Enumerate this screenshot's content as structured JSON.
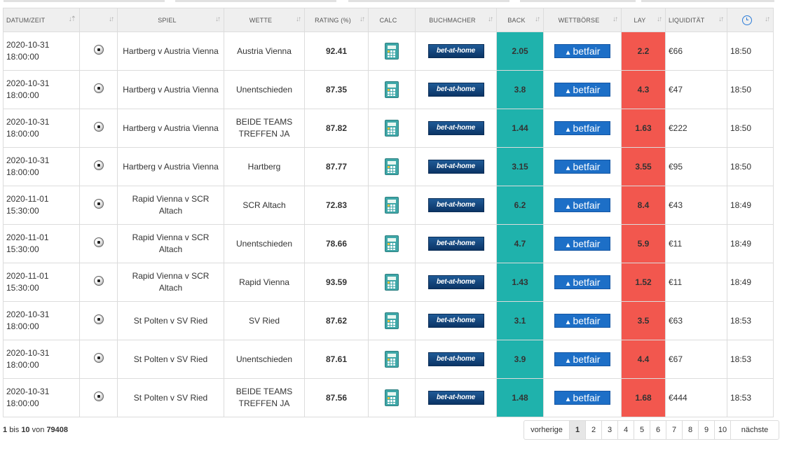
{
  "columns": {
    "datum": "DATUM/ZEIT",
    "spiel": "SPIEL",
    "wette": "WETTE",
    "rating": "RATING (%)",
    "calc": "CALC",
    "buchmacher": "BUCHMACHER",
    "back": "BACK",
    "wettboerse": "WETTBÖRSE",
    "lay": "LAY",
    "liquiditaet": "LIQUIDITÄT"
  },
  "icons": {
    "sport": "soccer-ball-icon",
    "calc": "calculator-icon",
    "bookmaker_logo": "bet-at-home-logo",
    "exchange_logo": "betfair-logo",
    "time_header": "clock-icon"
  },
  "logos": {
    "bookmaker": "bet-at-home",
    "exchange": "betfair"
  },
  "colors": {
    "back_bg": "#1fb2ac",
    "lay_bg": "#f2574e",
    "header_bg": "#efefef"
  },
  "rows": [
    {
      "date": "2020-10-31",
      "time": "18:00:00",
      "match": "Hartberg v Austria Vienna",
      "bet": "Austria Vienna",
      "rating": "92.41",
      "back": "2.05",
      "lay": "2.2",
      "liquidity": "€66",
      "updated": "18:50"
    },
    {
      "date": "2020-10-31",
      "time": "18:00:00",
      "match": "Hartberg v Austria Vienna",
      "bet": "Unentschieden",
      "rating": "87.35",
      "back": "3.8",
      "lay": "4.3",
      "liquidity": "€47",
      "updated": "18:50"
    },
    {
      "date": "2020-10-31",
      "time": "18:00:00",
      "match": "Hartberg v Austria Vienna",
      "bet": "BEIDE TEAMS TREFFEN JA",
      "rating": "87.82",
      "back": "1.44",
      "lay": "1.63",
      "liquidity": "€222",
      "updated": "18:50"
    },
    {
      "date": "2020-10-31",
      "time": "18:00:00",
      "match": "Hartberg v Austria Vienna",
      "bet": "Hartberg",
      "rating": "87.77",
      "back": "3.15",
      "lay": "3.55",
      "liquidity": "€95",
      "updated": "18:50"
    },
    {
      "date": "2020-11-01",
      "time": "15:30:00",
      "match": "Rapid Vienna v SCR Altach",
      "bet": "SCR Altach",
      "rating": "72.83",
      "back": "6.2",
      "lay": "8.4",
      "liquidity": "€43",
      "updated": "18:49"
    },
    {
      "date": "2020-11-01",
      "time": "15:30:00",
      "match": "Rapid Vienna v SCR Altach",
      "bet": "Unentschieden",
      "rating": "78.66",
      "back": "4.7",
      "lay": "5.9",
      "liquidity": "€11",
      "updated": "18:49"
    },
    {
      "date": "2020-11-01",
      "time": "15:30:00",
      "match": "Rapid Vienna v SCR Altach",
      "bet": "Rapid Vienna",
      "rating": "93.59",
      "back": "1.43",
      "lay": "1.52",
      "liquidity": "€11",
      "updated": "18:49"
    },
    {
      "date": "2020-10-31",
      "time": "18:00:00",
      "match": "St Polten v SV Ried",
      "bet": "SV Ried",
      "rating": "87.62",
      "back": "3.1",
      "lay": "3.5",
      "liquidity": "€63",
      "updated": "18:53"
    },
    {
      "date": "2020-10-31",
      "time": "18:00:00",
      "match": "St Polten v SV Ried",
      "bet": "Unentschieden",
      "rating": "87.61",
      "back": "3.9",
      "lay": "4.4",
      "liquidity": "€67",
      "updated": "18:53"
    },
    {
      "date": "2020-10-31",
      "time": "18:00:00",
      "match": "St Polten v SV Ried",
      "bet": "BEIDE TEAMS TREFFEN JA",
      "rating": "87.56",
      "back": "1.48",
      "lay": "1.68",
      "liquidity": "€444",
      "updated": "18:53"
    }
  ],
  "info": {
    "from": "1",
    "word_to": "bis",
    "to": "10",
    "word_of": "von",
    "total": "79408"
  },
  "pagination": {
    "prev": "vorherige",
    "pages": [
      "1",
      "2",
      "3",
      "4",
      "5",
      "6",
      "7",
      "8",
      "9",
      "10"
    ],
    "active": "1",
    "next": "nächste"
  }
}
